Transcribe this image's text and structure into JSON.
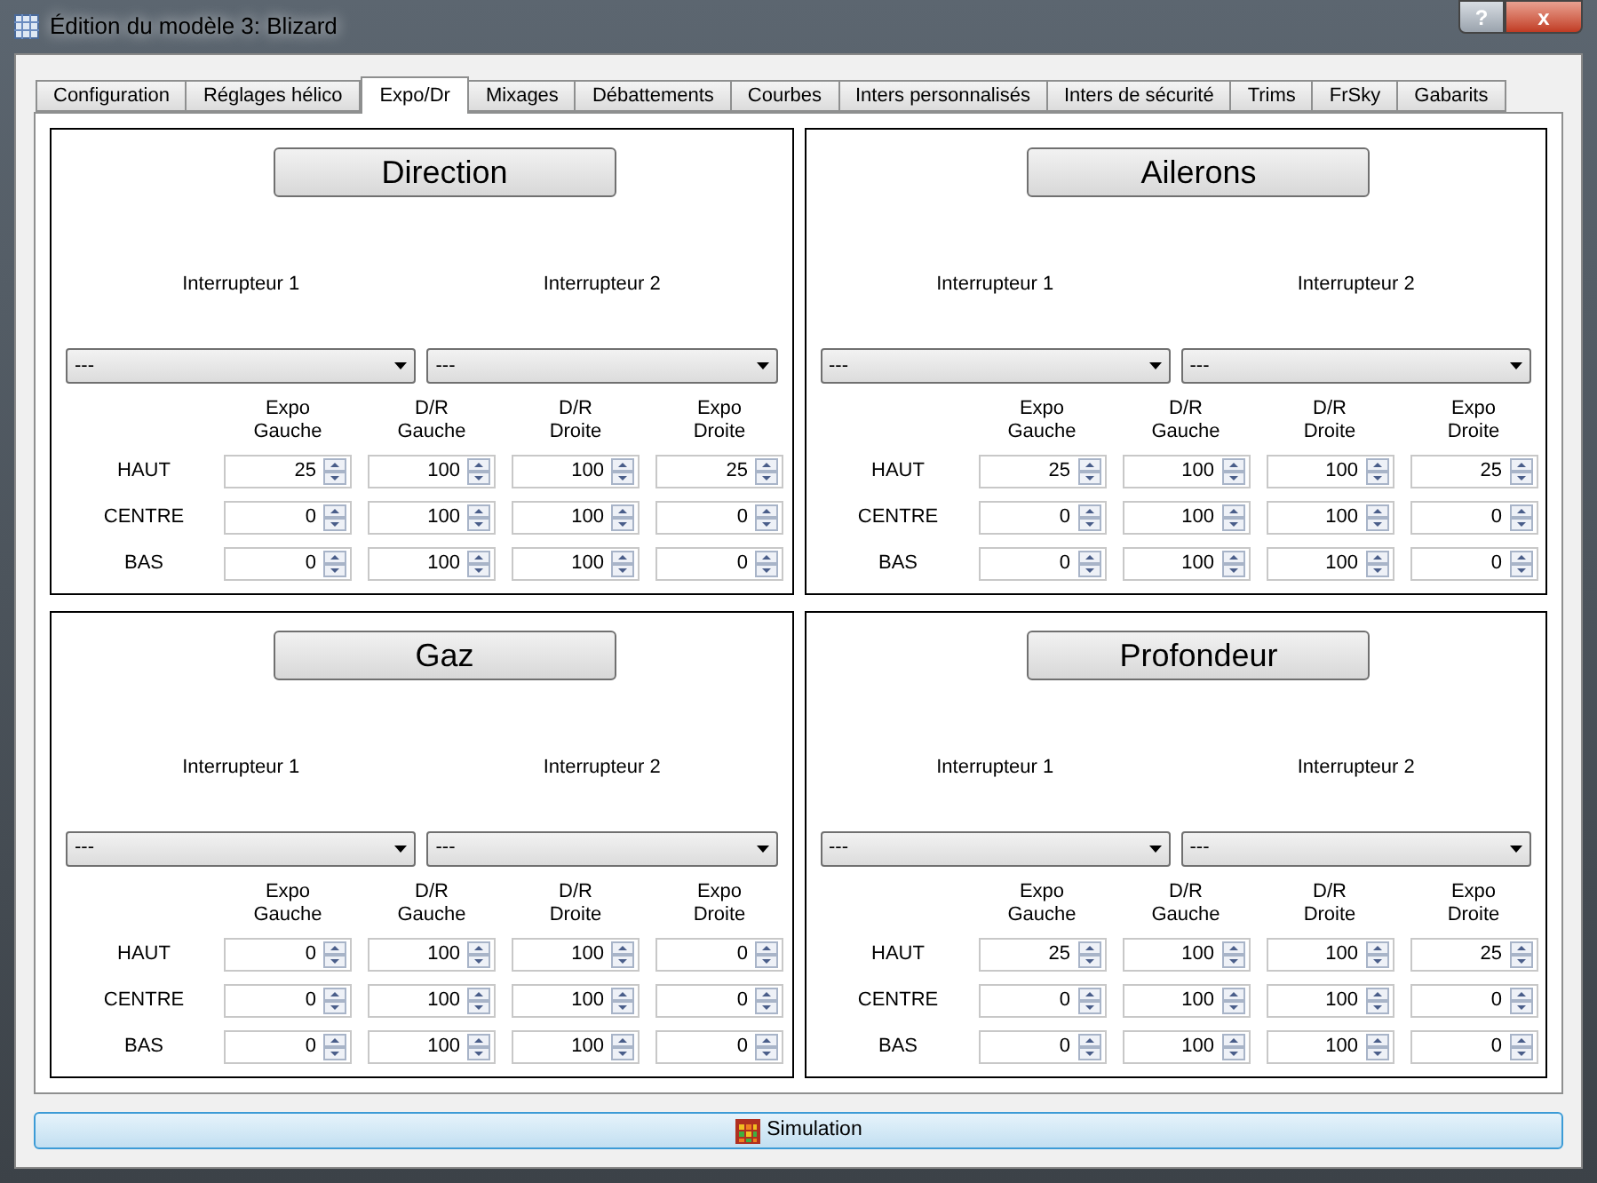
{
  "window": {
    "title": "Édition du modèle 3: Blizard",
    "help_button": "?",
    "close_button": "x"
  },
  "tabs": [
    {
      "label": "Configuration",
      "selected": false
    },
    {
      "label": "Réglages hélico",
      "selected": false
    },
    {
      "label": "Expo/Dr",
      "selected": true
    },
    {
      "label": "Mixages",
      "selected": false
    },
    {
      "label": "Débattements",
      "selected": false
    },
    {
      "label": "Courbes",
      "selected": false
    },
    {
      "label": "Inters personnalisés",
      "selected": false
    },
    {
      "label": "Inters de sécurité",
      "selected": false
    },
    {
      "label": "Trims",
      "selected": false
    },
    {
      "label": "FrSky",
      "selected": false
    },
    {
      "label": "Gabarits",
      "selected": false
    }
  ],
  "panels": [
    {
      "title": "Direction",
      "switch_labels": [
        "Interrupteur 1",
        "Interrupteur 2"
      ],
      "switches": [
        "---",
        "---"
      ],
      "columns": [
        "Expo\nGauche",
        "D/R\nGauche",
        "D/R\nDroite",
        "Expo\nDroite"
      ],
      "rows": [
        {
          "label": "HAUT",
          "values": [
            "25",
            "100",
            "100",
            "25"
          ]
        },
        {
          "label": "CENTRE",
          "values": [
            "0",
            "100",
            "100",
            "0"
          ]
        },
        {
          "label": "BAS",
          "values": [
            "0",
            "100",
            "100",
            "0"
          ]
        }
      ]
    },
    {
      "title": "Ailerons",
      "switch_labels": [
        "Interrupteur 1",
        "Interrupteur 2"
      ],
      "switches": [
        "---",
        "---"
      ],
      "columns": [
        "Expo\nGauche",
        "D/R\nGauche",
        "D/R\nDroite",
        "Expo\nDroite"
      ],
      "rows": [
        {
          "label": "HAUT",
          "values": [
            "25",
            "100",
            "100",
            "25"
          ]
        },
        {
          "label": "CENTRE",
          "values": [
            "0",
            "100",
            "100",
            "0"
          ]
        },
        {
          "label": "BAS",
          "values": [
            "0",
            "100",
            "100",
            "0"
          ]
        }
      ]
    },
    {
      "title": "Gaz",
      "switch_labels": [
        "Interrupteur 1",
        "Interrupteur 2"
      ],
      "switches": [
        "---",
        "---"
      ],
      "columns": [
        "Expo\nGauche",
        "D/R\nGauche",
        "D/R\nDroite",
        "Expo\nDroite"
      ],
      "rows": [
        {
          "label": "HAUT",
          "values": [
            "0",
            "100",
            "100",
            "0"
          ]
        },
        {
          "label": "CENTRE",
          "values": [
            "0",
            "100",
            "100",
            "0"
          ]
        },
        {
          "label": "BAS",
          "values": [
            "0",
            "100",
            "100",
            "0"
          ]
        }
      ]
    },
    {
      "title": "Profondeur",
      "switch_labels": [
        "Interrupteur 1",
        "Interrupteur 2"
      ],
      "switches": [
        "---",
        "---"
      ],
      "columns": [
        "Expo\nGauche",
        "D/R\nGauche",
        "D/R\nDroite",
        "Expo\nDroite"
      ],
      "rows": [
        {
          "label": "HAUT",
          "values": [
            "25",
            "100",
            "100",
            "25"
          ]
        },
        {
          "label": "CENTRE",
          "values": [
            "0",
            "100",
            "100",
            "0"
          ]
        },
        {
          "label": "BAS",
          "values": [
            "0",
            "100",
            "100",
            "0"
          ]
        }
      ]
    }
  ],
  "simulation_button": "Simulation"
}
